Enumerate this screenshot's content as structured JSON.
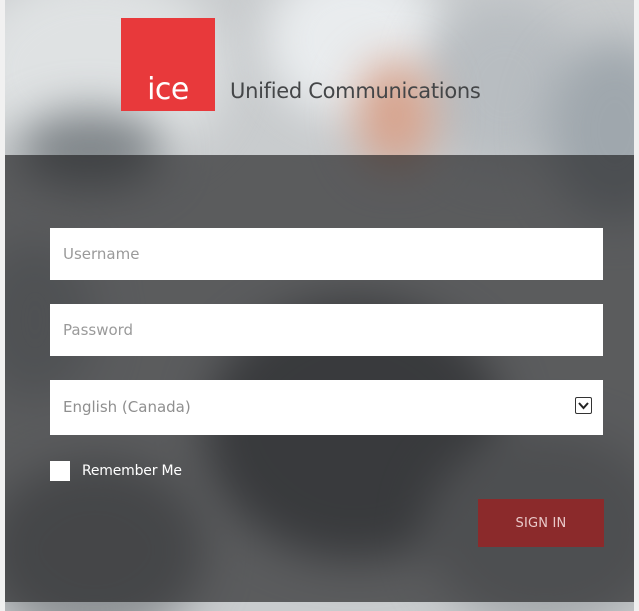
{
  "brand": {
    "logo_text": "ice",
    "product_title": "Unified Communications",
    "logo_color": "#e8393b"
  },
  "login": {
    "username_placeholder": "Username",
    "password_placeholder": "Password",
    "language_selected": "English (Canada)",
    "remember_label": "Remember Me",
    "remember_checked": false,
    "signin_label": "SIGN IN",
    "signin_color": "#8b2a2b"
  }
}
